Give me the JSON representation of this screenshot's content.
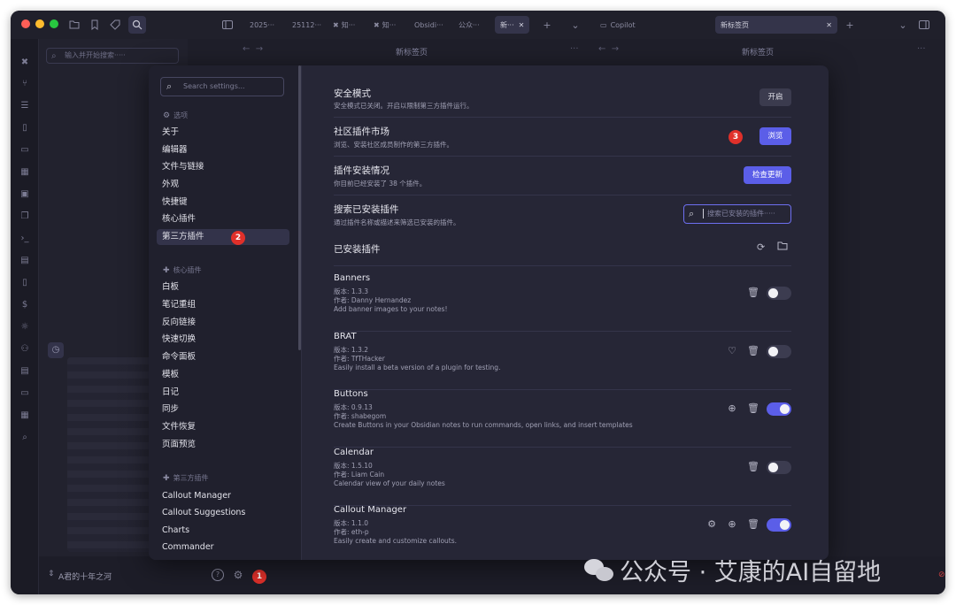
{
  "titlebar": {
    "tabs": [
      {
        "label": "2025···"
      },
      {
        "label": "25112···"
      },
      {
        "label": "知···"
      },
      {
        "label": "知···"
      },
      {
        "label": "Obsidi···"
      },
      {
        "label": "公众···"
      },
      {
        "label": "新···"
      }
    ],
    "copilot_label": "Copilot",
    "right_tab_label": "新标签页"
  },
  "leftpane": {
    "search_placeholder": "输入并开始搜索·····"
  },
  "background_panes": {
    "left_title": "新标签页",
    "right_title": "新标签页"
  },
  "settings": {
    "search_placeholder": "Search settings...",
    "options_header": "选项",
    "options_items": [
      "关于",
      "编辑器",
      "文件与链接",
      "外观",
      "快捷键",
      "核心插件",
      "第三方插件"
    ],
    "core_header": "核心插件",
    "core_items": [
      "白板",
      "笔记重组",
      "反向链接",
      "快速切换",
      "命令面板",
      "模板",
      "日记",
      "同步",
      "文件恢复",
      "页面预览"
    ],
    "third_header": "第三方插件",
    "third_items": [
      "Callout Manager",
      "Callout Suggestions",
      "Charts",
      "Commander"
    ],
    "safe_mode": {
      "title": "安全模式",
      "desc": "安全模式已关闭。开启以限制第三方插件运行。",
      "button": "开启"
    },
    "community": {
      "title": "社区插件市场",
      "desc": "浏览、安装社区成员制作的第三方插件。",
      "button": "浏览"
    },
    "install_status": {
      "title": "插件安装情况",
      "desc": "你目前已经安装了 38 个插件。",
      "button": "检查更新"
    },
    "search_installed": {
      "title": "搜索已安装插件",
      "desc": "通过插件名称或描述来筛选已安装的插件。",
      "placeholder": "搜索已安装的插件·····"
    },
    "installed_header": "已安装插件",
    "plugins": [
      {
        "name": "Banners",
        "version": "版本: 1.3.3",
        "author": "作者: Danny Hernandez",
        "desc": "Add banner images to your notes!",
        "enabled": false
      },
      {
        "name": "BRAT",
        "version": "版本: 1.3.2",
        "author": "作者: TfTHacker",
        "desc": "Easily install a beta version of a plugin for testing.",
        "enabled": false
      },
      {
        "name": "Buttons",
        "version": "版本: 0.9.13",
        "author": "作者: shabegom",
        "desc": "Create Buttons in your Obsidian notes to run commands, open links, and insert templates",
        "enabled": true
      },
      {
        "name": "Calendar",
        "version": "版本: 1.5.10",
        "author": "作者: Liam Cain",
        "desc": "Calendar view of your daily notes",
        "enabled": false
      },
      {
        "name": "Callout Manager",
        "version": "版本: 1.1.0",
        "author": "作者: eth-p",
        "desc": "Easily create and customize callouts.",
        "enabled": true
      }
    ]
  },
  "footer": {
    "vault_name": "A君的十年之河",
    "help_label": "?"
  },
  "badges": {
    "b1": "1",
    "b2": "2",
    "b3": "3"
  },
  "watermark": {
    "text": "公众号 · 艾康的AI自留地"
  },
  "colors": {
    "accent": "#5b5ee8",
    "badge": "#e0302a",
    "modal_bg": "#262636",
    "sidebar_bg": "#20202d"
  }
}
